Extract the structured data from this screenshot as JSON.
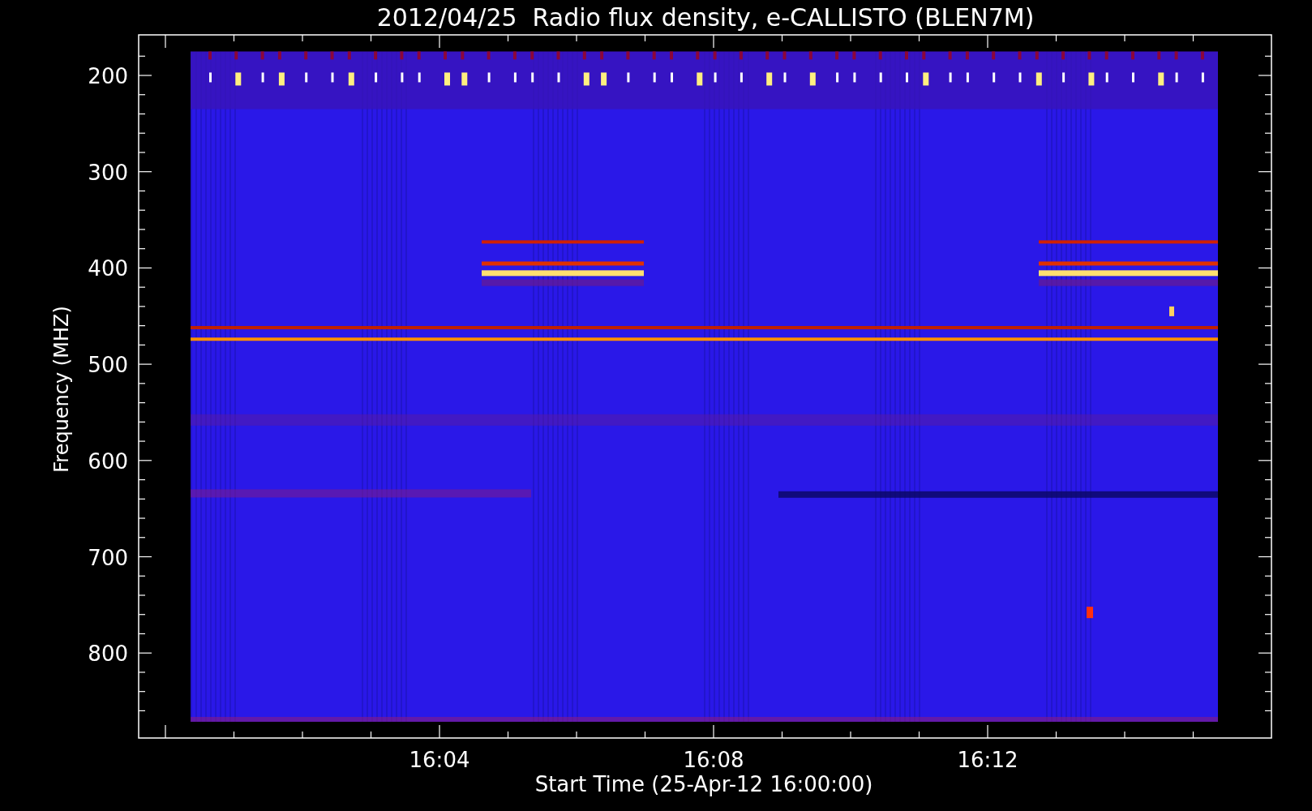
{
  "title": "2012/04/25  Radio flux density, e-CALLISTO (BLEN7M)",
  "y_axis": {
    "label": "Frequency (MHZ)",
    "ticks": [
      "200",
      "300",
      "400",
      "500",
      "600",
      "700",
      "800"
    ]
  },
  "x_axis": {
    "label": "Start Time (25-Apr-12 16:00:00)",
    "ticks": [
      "16:04",
      "16:08",
      "16:12"
    ]
  }
}
